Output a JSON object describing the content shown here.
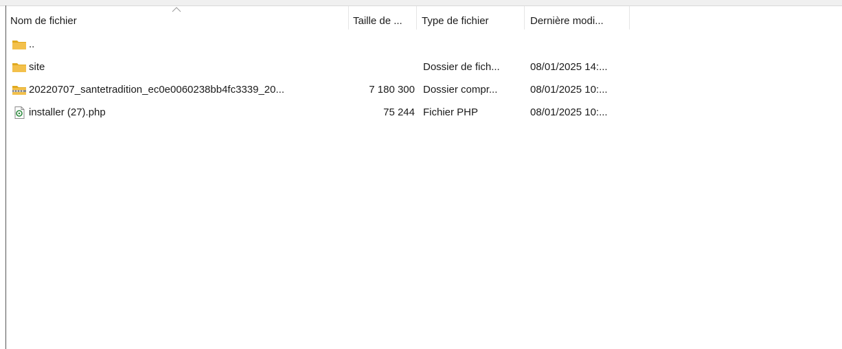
{
  "columns": {
    "name": "Nom de fichier",
    "size": "Taille de ...",
    "type": "Type de fichier",
    "date": "Dernière modi..."
  },
  "sort_icon": "chevron-up-icon",
  "rows": [
    {
      "icon": "folder-icon",
      "name": "..",
      "size": "",
      "type": "",
      "date": ""
    },
    {
      "icon": "folder-icon",
      "name": "site",
      "size": "",
      "type": "Dossier de fich...",
      "date": "08/01/2025 14:..."
    },
    {
      "icon": "zip-folder-icon",
      "name": "20220707_santetradition_ec0e0060238bb4fc3339_20...",
      "size": "7 180 300",
      "type": "Dossier compr...",
      "date": "08/01/2025 10:..."
    },
    {
      "icon": "php-file-icon",
      "name": "installer (27).php",
      "size": "75 244",
      "type": "Fichier PHP",
      "date": "08/01/2025 10:..."
    }
  ],
  "colors": {
    "folder": "#f3c04b",
    "folder_dark": "#e0a91e",
    "php_green": "#2d8a3e"
  }
}
